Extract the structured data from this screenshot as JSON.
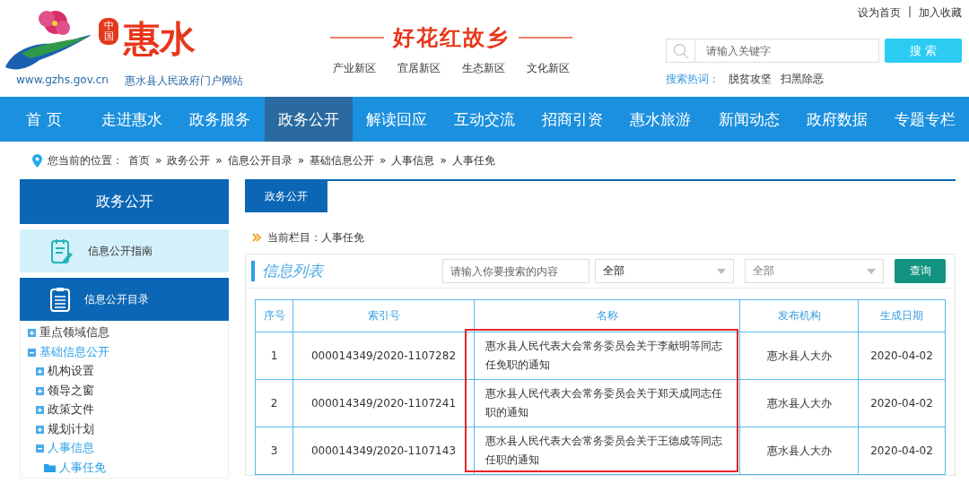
{
  "header": {
    "logo": {
      "badge": "中国",
      "name": "惠水",
      "url": "www.gzhs.gov.cn",
      "site_name": "惠水县人民政府门户网站"
    },
    "slogan": "好花红故乡",
    "zones": [
      "产业新区",
      "宜居新区",
      "生态新区",
      "文化新区"
    ],
    "top_links": [
      "设为首页",
      "|",
      "加入收藏"
    ],
    "search": {
      "placeholder": "请输入关键字",
      "button": "搜 索",
      "hot_label": "搜索热词：",
      "hot_words": [
        "脱贫攻坚",
        "扫黑除恶"
      ]
    }
  },
  "nav": [
    {
      "label": "首 页",
      "selected": false
    },
    {
      "label": "走进惠水",
      "selected": false
    },
    {
      "label": "政务服务",
      "selected": false
    },
    {
      "label": "政务公开",
      "selected": true
    },
    {
      "label": "解读回应",
      "selected": false
    },
    {
      "label": "互动交流",
      "selected": false
    },
    {
      "label": "招商引资",
      "selected": false
    },
    {
      "label": "惠水旅游",
      "selected": false
    },
    {
      "label": "新闻动态",
      "selected": false
    },
    {
      "label": "政府数据",
      "selected": false
    },
    {
      "label": "专题专栏",
      "selected": false
    }
  ],
  "breadcrumb": {
    "label": "您当前的位置：",
    "items": [
      {
        "label": "首页",
        "sep": "»"
      },
      {
        "label": "政务公开",
        "sep": "»"
      },
      {
        "label": "信息公开目录",
        "sep": "»"
      },
      {
        "label": "基础信息公开",
        "sep": "»"
      },
      {
        "label": "人事信息",
        "sep": "»"
      },
      {
        "label": "人事任免"
      }
    ]
  },
  "sidebar": {
    "title": "政务公开",
    "cards": [
      {
        "label": "信息公开指南",
        "selected": false,
        "kind": "guide"
      },
      {
        "label": "信息公开目录",
        "selected": true,
        "kind": "catalog"
      }
    ],
    "tree": [
      {
        "label": "重点领域信息",
        "kind": "branch",
        "expanded": false
      },
      {
        "label": "基础信息公开",
        "kind": "branch",
        "expanded": true,
        "children": [
          {
            "label": "机构设置",
            "kind": "branch",
            "expanded": false
          },
          {
            "label": "领导之窗",
            "kind": "branch",
            "expanded": false
          },
          {
            "label": "政策文件",
            "kind": "branch",
            "expanded": false
          },
          {
            "label": "规划计划",
            "kind": "branch",
            "expanded": false
          },
          {
            "label": "人事信息",
            "kind": "branch",
            "expanded": true,
            "children": [
              {
                "label": "人事任免",
                "kind": "leaf",
                "selected": true
              }
            ]
          }
        ]
      }
    ]
  },
  "main": {
    "tab": "政务公开",
    "current_column": "当前栏目：人事任免",
    "list_title": "信息列表",
    "filters": {
      "search_placeholder": "请输入你要搜索的内容",
      "select_1": {
        "value": "全部"
      },
      "select_2": {
        "placeholder": "全部"
      },
      "button": "查询"
    },
    "table": {
      "columns": [
        "序号",
        "索引号",
        "名称",
        "发布机构",
        "生成日期"
      ],
      "rows": [
        [
          "1",
          "000014349/2020-1107282",
          "惠水县人民代表大会常务委员会关于李献明等同志任免职的通知",
          "惠水县人大办",
          "2020-04-02"
        ],
        [
          "2",
          "000014349/2020-1107241",
          "惠水县人民代表大会常务委员会关于郑天成同志任职的通知",
          "惠水县人大办",
          "2020-04-02"
        ],
        [
          "3",
          "000014349/2020-1107143",
          "惠水县人民代表大会常务委员会关于王德成等同志任职的通知",
          "惠水县人大办",
          "2020-04-02"
        ]
      ]
    }
  }
}
